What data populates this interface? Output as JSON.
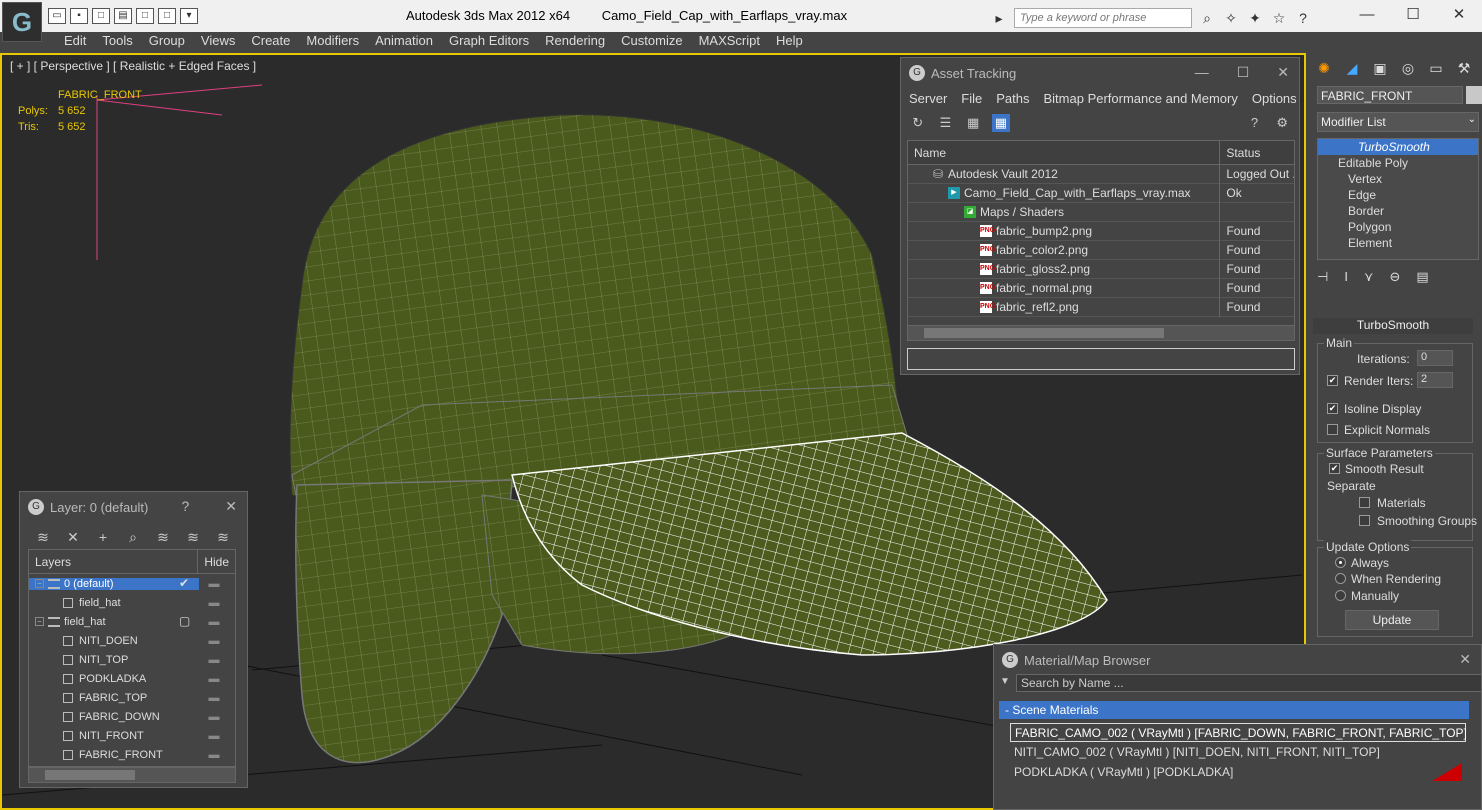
{
  "titlebar": {
    "app_name": "Autodesk 3ds Max  2012 x64",
    "file_name": "Camo_Field_Cap_with_Earflaps_vray.max",
    "search_placeholder": "Type a keyword or phrase",
    "minimize": "—",
    "maximize": "☐",
    "close": "✕"
  },
  "menu": [
    "Edit",
    "Tools",
    "Group",
    "Views",
    "Create",
    "Modifiers",
    "Animation",
    "Graph Editors",
    "Rendering",
    "Customize",
    "MAXScript",
    "Help"
  ],
  "viewport": {
    "label": "[ + ] [ Perspective ] [ Realistic + Edged Faces ]",
    "selected_name": "FABRIC_FRONT",
    "polys_label": "Polys:",
    "polys_value": "5 652",
    "tris_label": "Tris:",
    "tris_value": "5 652",
    "model_color": "#4a5a1c"
  },
  "asset_tracking": {
    "title": "Asset Tracking",
    "menu": [
      "Server",
      "File",
      "Paths",
      "Bitmap Performance and Memory",
      "Options"
    ],
    "col_name": "Name",
    "col_status": "Status",
    "rows": [
      {
        "name": "Autodesk Vault 2012",
        "status": "Logged Out ...",
        "icon": "vault-icon"
      },
      {
        "name": "Camo_Field_Cap_with_Earflaps_vray.max",
        "status": "Ok",
        "icon": "max-file-icon"
      },
      {
        "name": "Maps / Shaders",
        "status": "",
        "icon": "maps-icon"
      },
      {
        "name": "fabric_bump2.png",
        "status": "Found",
        "icon": "png-icon"
      },
      {
        "name": "fabric_color2.png",
        "status": "Found",
        "icon": "png-icon"
      },
      {
        "name": "fabric_gloss2.png",
        "status": "Found",
        "icon": "png-icon"
      },
      {
        "name": "fabric_normal.png",
        "status": "Found",
        "icon": "png-icon"
      },
      {
        "name": "fabric_refl2.png",
        "status": "Found",
        "icon": "png-icon"
      }
    ]
  },
  "command_panel": {
    "object_name": "FABRIC_FRONT",
    "modifier_list": "Modifier List",
    "stack": {
      "turbosmooth": "TurboSmooth",
      "editable_poly": "Editable Poly",
      "vertex": "Vertex",
      "edge": "Edge",
      "border": "Border",
      "polygon": "Polygon",
      "element": "Element"
    },
    "rollout_title": "TurboSmooth",
    "main_group": "Main",
    "iterations_label": "Iterations:",
    "iterations_value": "0",
    "render_iters_label": "Render Iters:",
    "render_iters_value": "2",
    "isoline_label": "Isoline Display",
    "explicit_normals_label": "Explicit Normals",
    "surface_group": "Surface Parameters",
    "smooth_result_label": "Smooth Result",
    "separate_label": "Separate",
    "materials_label": "Materials",
    "smoothing_groups_label": "Smoothing Groups",
    "update_group": "Update Options",
    "always_label": "Always",
    "when_rendering_label": "When Rendering",
    "manually_label": "Manually",
    "update_button": "Update"
  },
  "layers": {
    "title": "Layer: 0 (default)",
    "help": "?",
    "close": "✕",
    "col_layers": "Layers",
    "col_hide": "Hide",
    "rows": [
      {
        "name": "0 (default)",
        "kind": "layer",
        "selected": true
      },
      {
        "name": "field_hat",
        "kind": "object"
      },
      {
        "name": "field_hat",
        "kind": "layer"
      },
      {
        "name": "NITI_DOEN",
        "kind": "object"
      },
      {
        "name": "NITI_TOP",
        "kind": "object"
      },
      {
        "name": "PODKLADKA",
        "kind": "object"
      },
      {
        "name": "FABRIC_TOP",
        "kind": "object"
      },
      {
        "name": "FABRIC_DOWN",
        "kind": "object"
      },
      {
        "name": "NITI_FRONT",
        "kind": "object"
      },
      {
        "name": "FABRIC_FRONT",
        "kind": "object"
      }
    ]
  },
  "material_browser": {
    "title": "Material/Map Browser",
    "close": "✕",
    "search_placeholder": "Search by Name ...",
    "section": "- Scene Materials",
    "materials": [
      "FABRIC_CAMO_002  ( VRayMtl )  [FABRIC_DOWN, FABRIC_FRONT, FABRIC_TOP]",
      "NITI_CAMO_002  ( VRayMtl )  [NITI_DOEN, NITI_FRONT, NITI_TOP]",
      "PODKLADKA  ( VRayMtl )  [PODKLADKA]"
    ]
  }
}
